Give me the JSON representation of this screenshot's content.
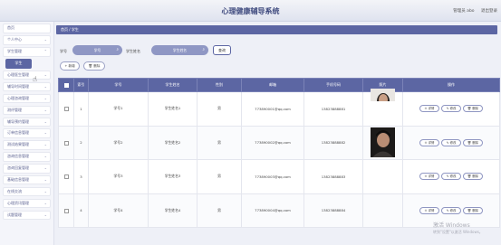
{
  "header": {
    "title": "心理健康辅导系统",
    "user": "管理员 abo",
    "logout": "退出登录"
  },
  "sidebar": {
    "items": [
      {
        "label": "首页",
        "chevron": false
      },
      {
        "label": "个人中心",
        "chevron": true
      },
      {
        "label": "学生管理",
        "chevron": true
      },
      {
        "label": "学生",
        "sub": true
      },
      {
        "label": "心理医生管理",
        "chevron": true
      },
      {
        "label": "辅导时间管理",
        "chevron": true
      },
      {
        "label": "心理咨询管理",
        "chevron": true
      },
      {
        "label": "测评管理",
        "chevron": true
      },
      {
        "label": "辅导预约管理",
        "chevron": true
      },
      {
        "label": "订单信息管理",
        "chevron": true
      },
      {
        "label": "测试结果管理",
        "chevron": true
      },
      {
        "label": "咨询信息管理",
        "chevron": true
      },
      {
        "label": "咨询回复管理",
        "chevron": true
      },
      {
        "label": "基础信息管理",
        "chevron": true
      },
      {
        "label": "在线交流",
        "chevron": true
      },
      {
        "label": "心理资讯管理",
        "chevron": true
      },
      {
        "label": "试题管理",
        "chevron": true
      }
    ]
  },
  "breadcrumb": {
    "home": "首页",
    "sep": "/",
    "current": "学生"
  },
  "search": {
    "label1": "学号",
    "placeholder1": "学号",
    "label2": "学生姓名",
    "placeholder2": "学生姓名",
    "button": "查询"
  },
  "actions": {
    "add": "+ 新增",
    "delete": "删除"
  },
  "table": {
    "headers": [
      "索引",
      "学号",
      "学生姓名",
      "性别",
      "邮箱",
      "手机号码",
      "照片",
      "操作"
    ],
    "rows": [
      {
        "index": "1",
        "xuehao": "学号1",
        "name": "学生姓名1",
        "gender": "男",
        "email": "773890001@qq.com",
        "phone": "13823888881"
      },
      {
        "index": "2",
        "xuehao": "学号2",
        "name": "学生姓名2",
        "gender": "男",
        "email": "773890002@qq.com",
        "phone": "13823888882"
      },
      {
        "index": "3",
        "xuehao": "学号3",
        "name": "学生姓名3",
        "gender": "男",
        "email": "773890003@qq.com",
        "phone": "13823888883"
      },
      {
        "index": "4",
        "xuehao": "学号4",
        "name": "学生姓名4",
        "gender": "男",
        "email": "773890004@qq.com",
        "phone": "13823888884"
      }
    ],
    "ops": {
      "detail": "详情",
      "edit": "修改",
      "delete": "删除"
    }
  },
  "watermark": {
    "line1": "激活 Windows",
    "line2": "转到\"设置\"以激活 Windows。"
  },
  "colors": {
    "primary": "#5c66a3",
    "pill": "#8f97c4",
    "title": "#3f4a7e"
  }
}
